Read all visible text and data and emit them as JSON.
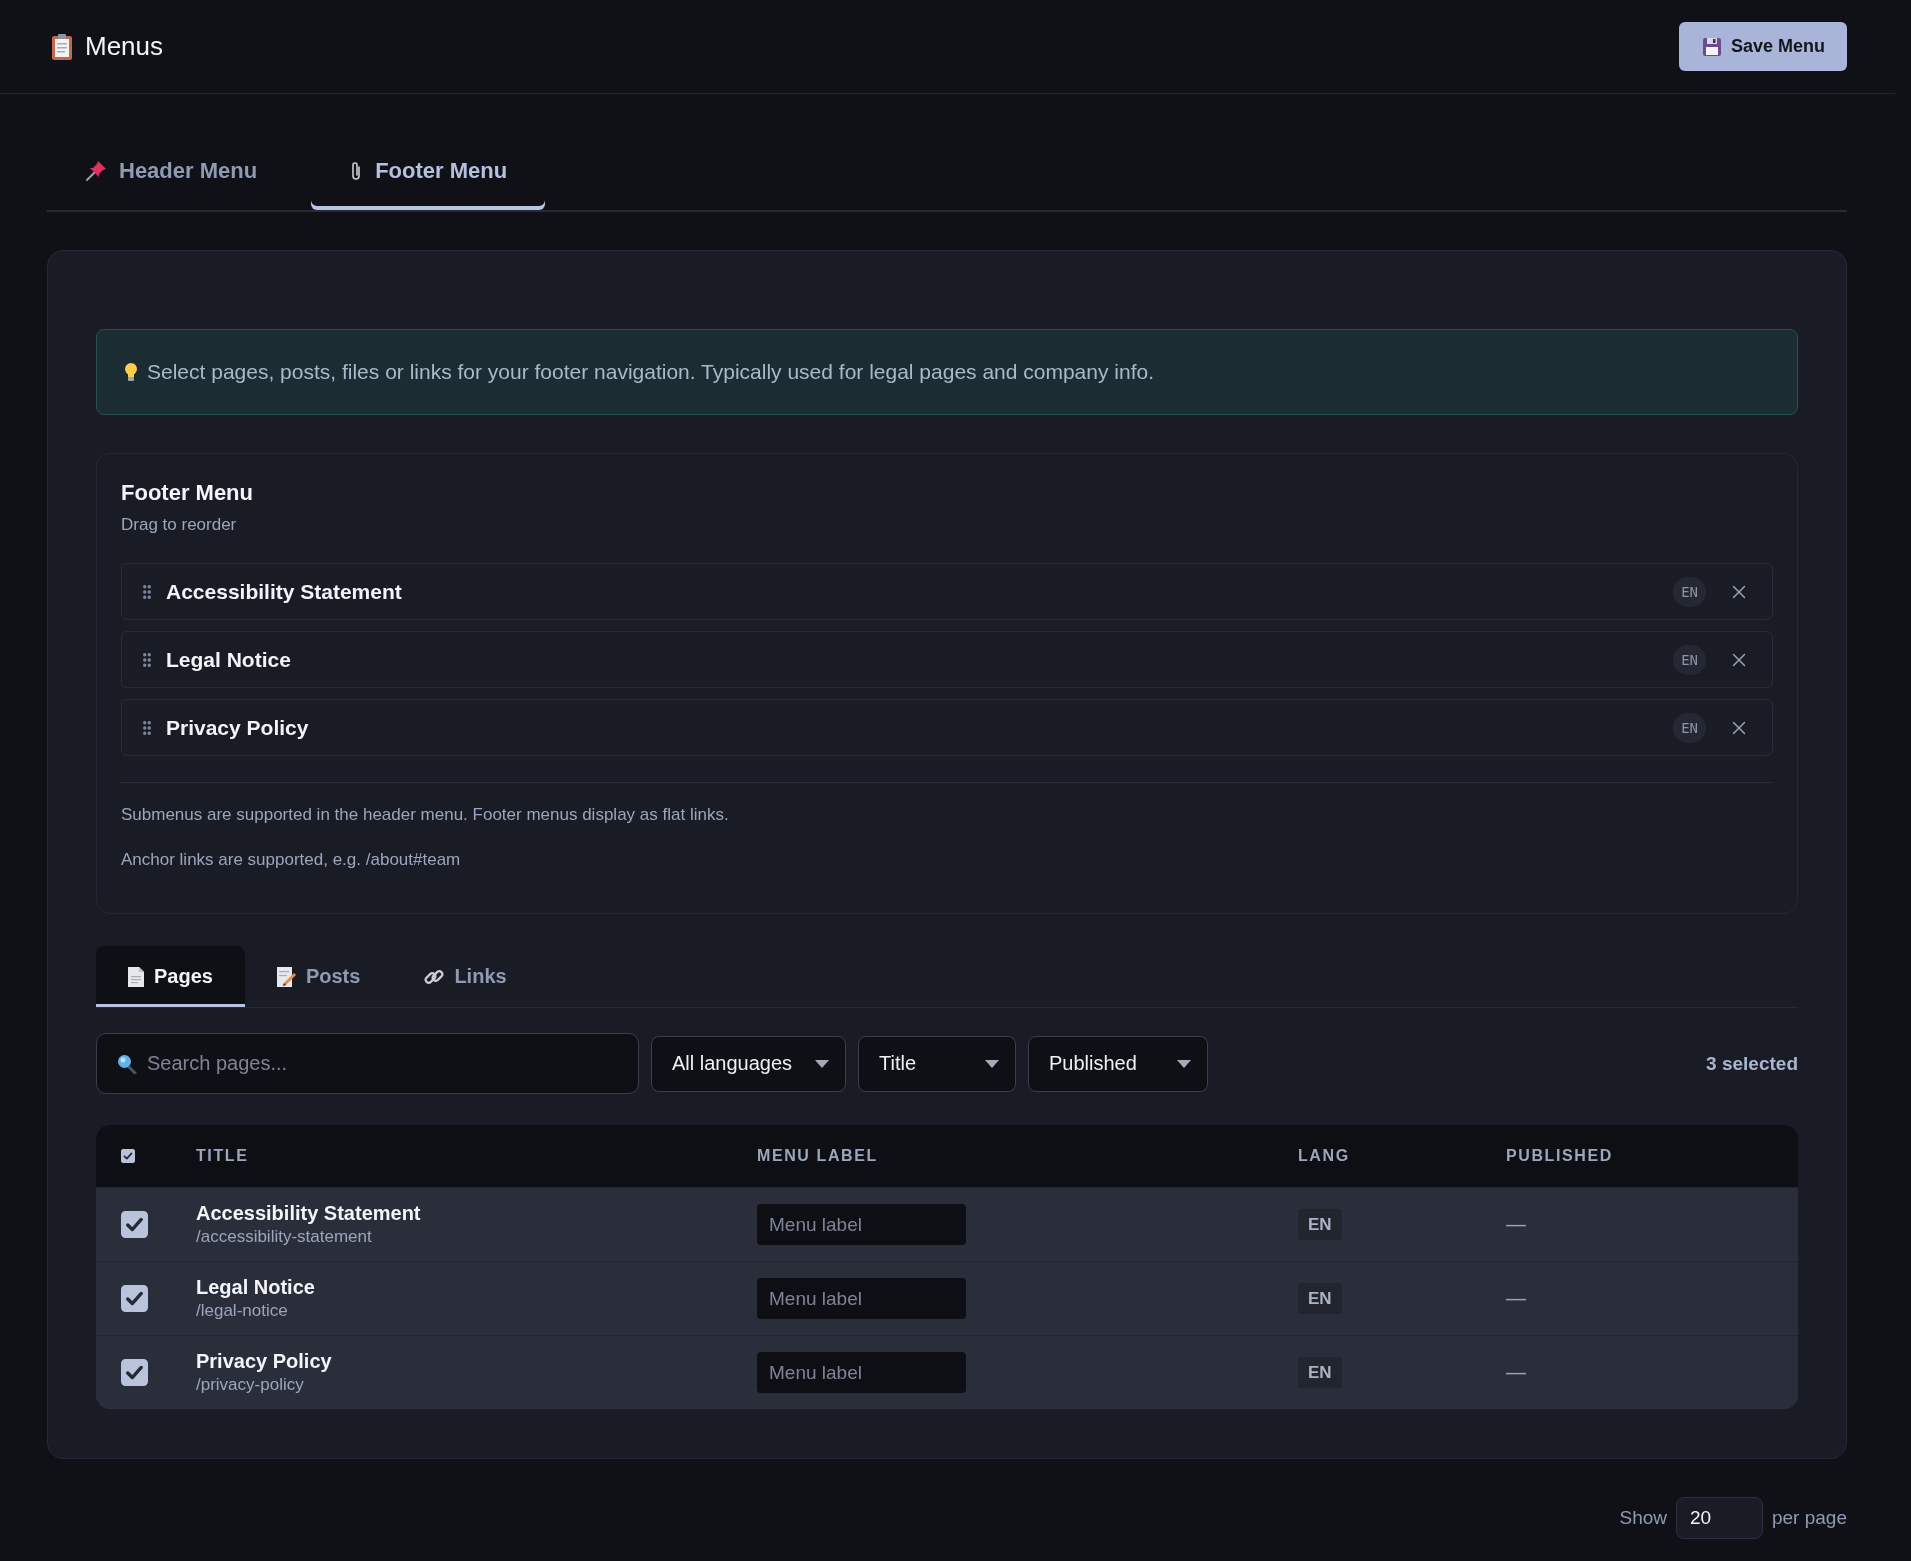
{
  "header": {
    "title": "Menus",
    "save_button": "Save Menu"
  },
  "menu_tabs": [
    {
      "label": "Header Menu",
      "selected": false
    },
    {
      "label": "Footer Menu",
      "selected": true
    }
  ],
  "info_banner": {
    "text": "Select pages, posts, files or links for your footer navigation. Typically used for legal pages and company info."
  },
  "menu_card": {
    "title": "Footer Menu",
    "subtitle": "Drag to reorder",
    "items": [
      {
        "label": "Accessibility Statement",
        "lang": "EN"
      },
      {
        "label": "Legal Notice",
        "lang": "EN"
      },
      {
        "label": "Privacy Policy",
        "lang": "EN"
      }
    ],
    "notes": [
      "Submenus are supported in the header menu. Footer menus display as flat links.",
      "Anchor links are supported, e.g. /about#team"
    ]
  },
  "source_tabs": [
    {
      "label": "Pages",
      "selected": true
    },
    {
      "label": "Posts",
      "selected": false
    },
    {
      "label": "Links",
      "selected": false
    }
  ],
  "filters": {
    "search": {
      "placeholder": "Search pages..."
    },
    "selects": [
      {
        "value": "All languages"
      },
      {
        "value": "Title"
      },
      {
        "value": "Published"
      }
    ],
    "selection_count": "3 selected"
  },
  "table": {
    "select_all": {
      "checked": true
    },
    "columns": [
      "TITLE",
      "MENU LABEL",
      "LANG",
      "PUBLISHED"
    ],
    "rows": [
      {
        "selected": true,
        "title": "Accessibility Statement",
        "path": "/accessibility-statement",
        "menu_label": {
          "placeholder": "Menu label"
        },
        "lang": "EN",
        "published": "—"
      },
      {
        "selected": true,
        "title": "Legal Notice",
        "path": "/legal-notice",
        "menu_label": {
          "placeholder": "Menu label"
        },
        "lang": "EN",
        "published": "—"
      },
      {
        "selected": true,
        "title": "Privacy Policy",
        "path": "/privacy-policy",
        "menu_label": {
          "placeholder": "Menu label"
        },
        "lang": "EN",
        "published": "—"
      }
    ]
  },
  "pagination": {
    "label": "Show",
    "page_size": "20",
    "suffix": "per page"
  }
}
